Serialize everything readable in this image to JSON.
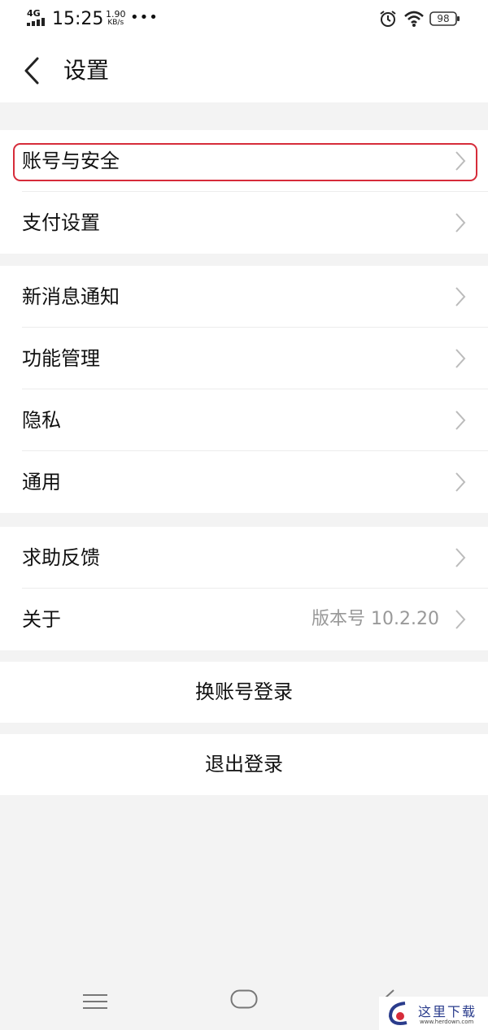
{
  "status_bar": {
    "network": "4G",
    "time": "15:25",
    "speed_value": "1.90",
    "speed_unit": "KB/s",
    "more": "•••",
    "battery": "98"
  },
  "header": {
    "title": "设置"
  },
  "groups": [
    {
      "items": [
        {
          "label": "账号与安全"
        },
        {
          "label": "支付设置"
        }
      ]
    },
    {
      "items": [
        {
          "label": "新消息通知"
        },
        {
          "label": "功能管理"
        },
        {
          "label": "隐私"
        },
        {
          "label": "通用"
        }
      ]
    },
    {
      "items": [
        {
          "label": "求助反馈"
        },
        {
          "label": "关于",
          "value": "版本号 10.2.20"
        }
      ]
    }
  ],
  "actions": {
    "switch_account": "换账号登录",
    "logout": "退出登录"
  },
  "watermark": {
    "title": "这里下载",
    "url": "www.herdown.com"
  },
  "colors": {
    "highlight": "#d62c3a",
    "background": "#f3f3f3",
    "secondary_text": "#999999"
  }
}
